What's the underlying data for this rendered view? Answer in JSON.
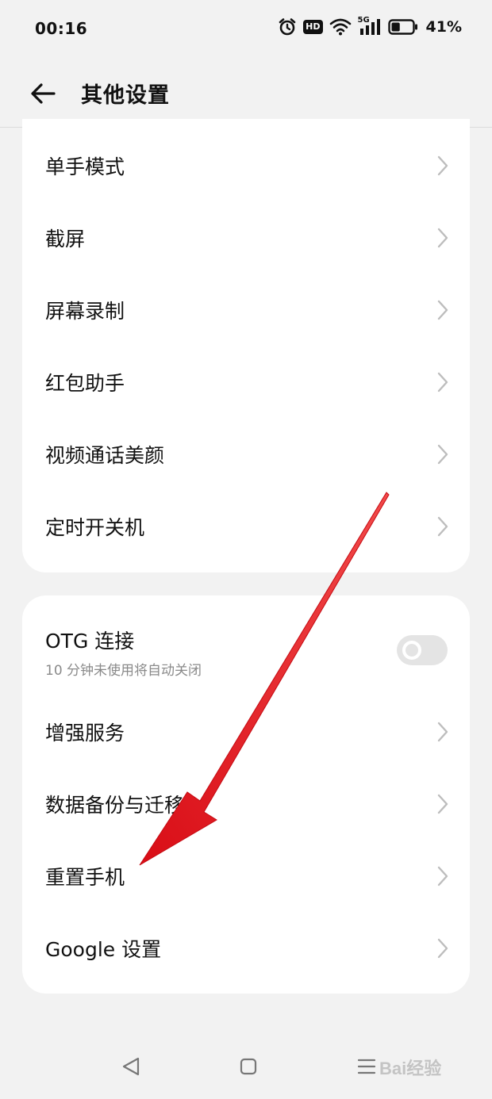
{
  "status_bar": {
    "time": "00:16",
    "hd_badge": "HD",
    "network_badge": "5G",
    "battery_percent": "41%",
    "battery_level": 0.41,
    "icons": [
      "alarm-icon",
      "hd-icon",
      "wifi-icon",
      "signal-5g-icon",
      "battery-icon"
    ]
  },
  "header": {
    "title": "其他设置",
    "back_icon": "back-arrow-icon"
  },
  "group1": {
    "items": [
      {
        "label": "单手模式"
      },
      {
        "label": "截屏"
      },
      {
        "label": "屏幕录制"
      },
      {
        "label": "红包助手"
      },
      {
        "label": "视频通话美颜"
      },
      {
        "label": "定时开关机"
      }
    ]
  },
  "group2": {
    "otg": {
      "title": "OTG 连接",
      "subtitle": "10 分钟未使用将自动关闭",
      "enabled": false
    },
    "items": [
      {
        "label": "增强服务"
      },
      {
        "label": "数据备份与迁移"
      },
      {
        "label": "重置手机"
      },
      {
        "label": "Google 设置"
      }
    ]
  },
  "nav_bar": {
    "icons": [
      "nav-back-icon",
      "nav-home-icon",
      "nav-menu-icon"
    ]
  },
  "watermark": {
    "text": "Bai经验"
  },
  "colors": {
    "background": "#f2f2f2",
    "card": "#ffffff",
    "annotation_arrow": "#e8141c",
    "toggle_off": "#e4e4e4"
  }
}
